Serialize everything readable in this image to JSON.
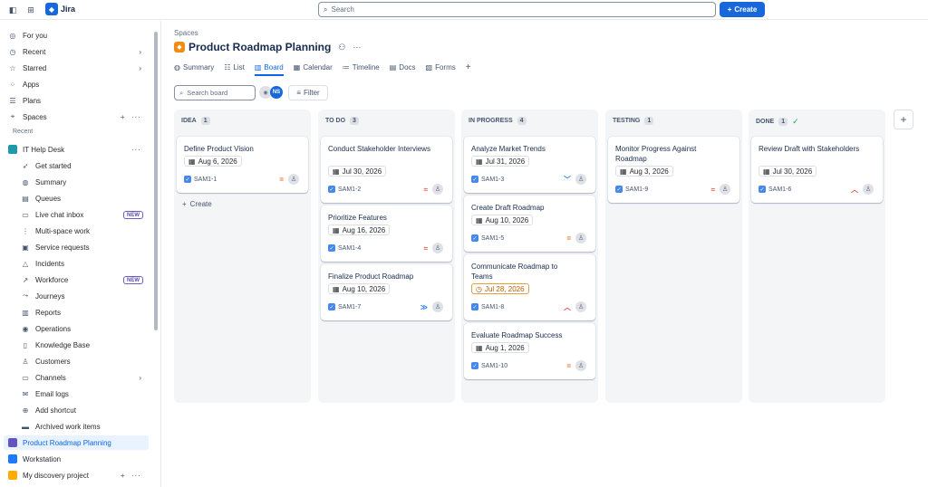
{
  "topbar": {
    "app_name": "Jira",
    "search_placeholder": "Search",
    "create_label": "Create"
  },
  "sidebar": {
    "for_you": "For you",
    "recent": "Recent",
    "starred": "Starred",
    "apps": "Apps",
    "plans": "Plans",
    "spaces": "Spaces",
    "recent_section": "Recent",
    "it_help_desk": "IT Help Desk",
    "sub_items": [
      {
        "label": "Get started",
        "icon": "rocket-icon"
      },
      {
        "label": "Summary",
        "icon": "globe-icon"
      },
      {
        "label": "Queues",
        "icon": "queue-icon"
      },
      {
        "label": "Live chat inbox",
        "icon": "chat-icon",
        "badge": "NEW"
      },
      {
        "label": "Multi-space work",
        "icon": "multi-space-icon"
      },
      {
        "label": "Service requests",
        "icon": "service-icon"
      },
      {
        "label": "Incidents",
        "icon": "warning-icon"
      },
      {
        "label": "Workforce",
        "icon": "trend-icon",
        "badge": "NEW"
      },
      {
        "label": "Journeys",
        "icon": "journey-icon"
      },
      {
        "label": "Reports",
        "icon": "chart-icon"
      },
      {
        "label": "Operations",
        "icon": "operations-icon"
      },
      {
        "label": "Knowledge Base",
        "icon": "book-icon"
      },
      {
        "label": "Customers",
        "icon": "person-icon"
      },
      {
        "label": "Channels",
        "icon": "monitor-icon"
      },
      {
        "label": "Email logs",
        "icon": "mail-icon"
      },
      {
        "label": "Add shortcut",
        "icon": "link-icon"
      },
      {
        "label": "Archived work items",
        "icon": "archive-icon"
      }
    ],
    "projects": [
      {
        "label": "Product Roadmap Planning",
        "color": "#6554c0"
      },
      {
        "label": "Workstation",
        "color": "#1d7afc"
      },
      {
        "label": "My discovery project",
        "color": "#ffab00"
      }
    ]
  },
  "header": {
    "breadcrumb": "Spaces",
    "title": "Product Roadmap Planning",
    "more": "···",
    "tabs": [
      {
        "label": "Summary",
        "icon": "globe-icon"
      },
      {
        "label": "List",
        "icon": "list-icon"
      },
      {
        "label": "Board",
        "icon": "board-icon",
        "active": true
      },
      {
        "label": "Calendar",
        "icon": "calendar-icon"
      },
      {
        "label": "Timeline",
        "icon": "timeline-icon"
      },
      {
        "label": "Docs",
        "icon": "docs-icon"
      },
      {
        "label": "Forms",
        "icon": "forms-icon"
      }
    ],
    "add_tab": "+"
  },
  "toolbar": {
    "search_placeholder": "Search board",
    "avatar_initials": "NS",
    "filter_label": "Filter"
  },
  "columns": [
    {
      "name": "IDEA",
      "count": "1",
      "cards": [
        {
          "title": "Define Product Vision",
          "date": "Aug 6, 2026",
          "key": "SAM1-1",
          "priority": "medium"
        }
      ],
      "create_label": "Create"
    },
    {
      "name": "TO DO",
      "count": "3",
      "cards": [
        {
          "title": "Conduct Stakeholder Interviews",
          "date": "Jul 30, 2026",
          "key": "SAM1-2",
          "priority": "highest"
        },
        {
          "title": "Prioritize Features",
          "date": "Aug 16, 2026",
          "key": "SAM1-4",
          "priority": "highest"
        },
        {
          "title": "Finalize Product Roadmap",
          "date": "Aug 10, 2026",
          "key": "SAM1-7",
          "priority": "lowest"
        }
      ]
    },
    {
      "name": "IN PROGRESS",
      "count": "4",
      "cards": [
        {
          "title": "Analyze Market Trends",
          "date": "Jul 31, 2026",
          "key": "SAM1-3",
          "priority": "low"
        },
        {
          "title": "Create Draft Roadmap",
          "date": "Aug 10, 2026",
          "key": "SAM1-5",
          "priority": "medium"
        },
        {
          "title": "Communicate Roadmap to Teams",
          "date": "Jul 28, 2026",
          "key": "SAM1-8",
          "priority": "high",
          "overdue": true
        },
        {
          "title": "Evaluate Roadmap Success",
          "date": "Aug 1, 2026",
          "key": "SAM1-10",
          "priority": "medium"
        }
      ]
    },
    {
      "name": "TESTING",
      "count": "1",
      "cards": [
        {
          "title": "Monitor Progress Against Roadmap",
          "date": "Aug 3, 2026",
          "key": "SAM1-9",
          "priority": "highest"
        }
      ]
    },
    {
      "name": "DONE",
      "count": "1",
      "cards": [
        {
          "title": "Review Draft with Stakeholders",
          "date": "Jul 30, 2026",
          "key": "SAM1-6",
          "priority": "high"
        }
      ]
    }
  ],
  "colors": {
    "accent": "#1868db",
    "priority_highest": "#e2483d",
    "priority_high": "#e2483d",
    "priority_medium": "#e56910",
    "priority_low": "#1d7afc",
    "priority_lowest": "#1d7afc"
  }
}
